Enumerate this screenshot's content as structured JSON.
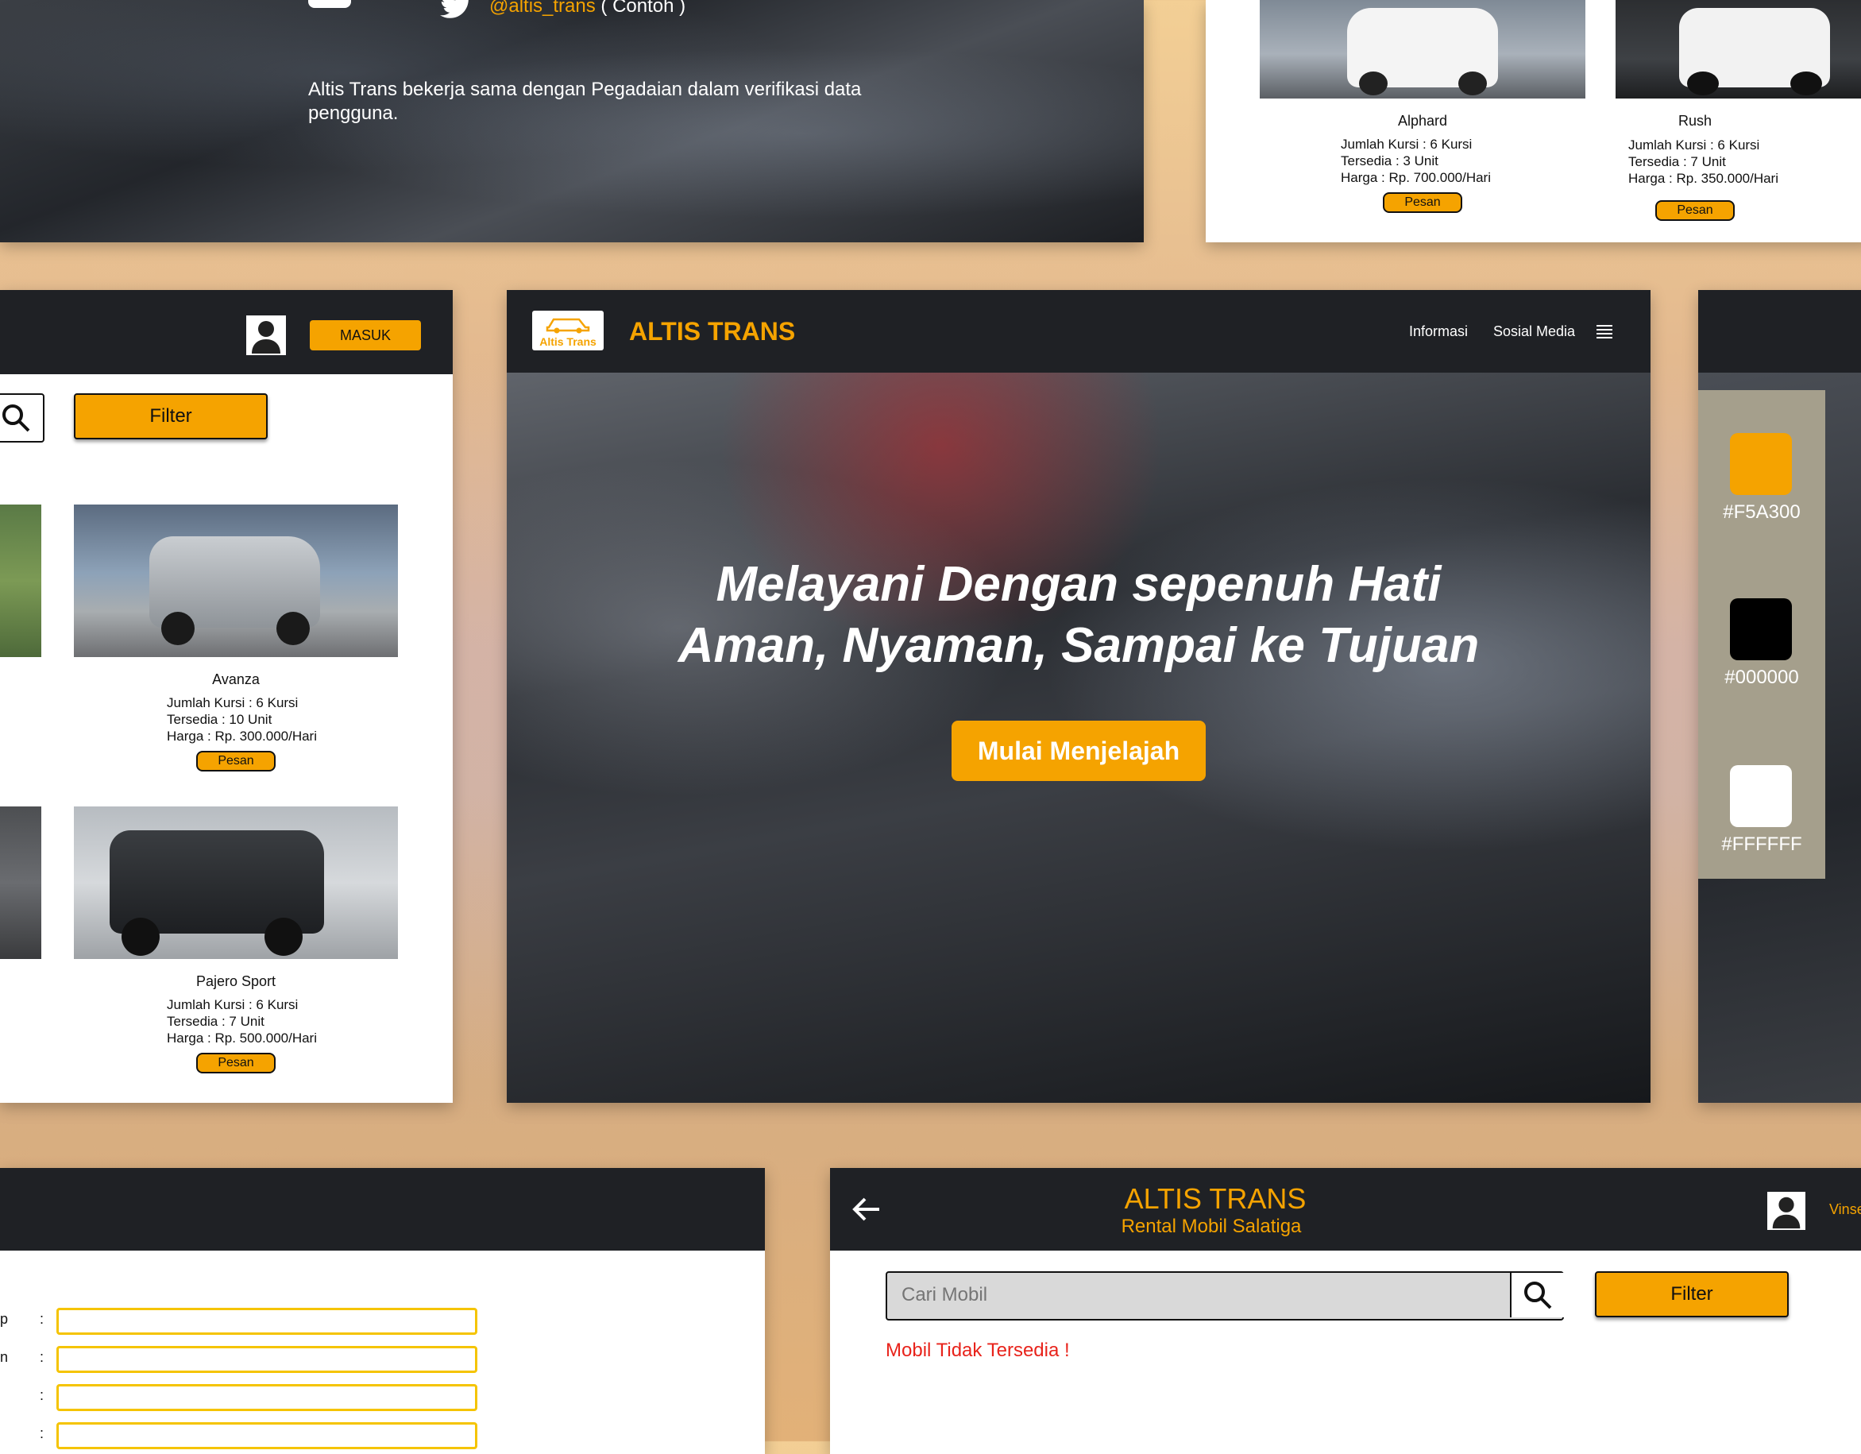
{
  "colors": {
    "accent": "#F5A300",
    "black": "#000000",
    "white": "#FFFFFF",
    "dark_bar": "#1f2125",
    "error": "#e8231b"
  },
  "top_left": {
    "twitter_handle": "@altis_trans",
    "twitter_note": " ( Contoh )",
    "description": "Altis Trans bekerja sama dengan Pegadaian dalam verifikasi data pengguna."
  },
  "top_right": {
    "cars": [
      {
        "name": "Alphard",
        "seats": "Jumlah Kursi : 6 Kursi",
        "stock": "Tersedia : 3 Unit",
        "price": "Harga : Rp. 700.000/Hari",
        "button": "Pesan"
      },
      {
        "name": "Rush",
        "seats": "Jumlah Kursi : 6 Kursi",
        "stock": "Tersedia : 7 Unit",
        "price": "Harga : Rp. 350.000/Hari",
        "button": "Pesan"
      }
    ]
  },
  "left_panel": {
    "login_button": "MASUK",
    "filter_button": "Filter",
    "cars": [
      {
        "name": "Avanza",
        "seats": "Jumlah Kursi : 6 Kursi",
        "stock": "Tersedia : 10 Unit",
        "price": "Harga : Rp. 300.000/Hari",
        "button": "Pesan"
      },
      {
        "name": "Pajero Sport",
        "seats": "Jumlah Kursi : 6 Kursi",
        "stock": "Tersedia : 7 Unit",
        "price": "Harga : Rp. 500.000/Hari",
        "button": "Pesan"
      }
    ]
  },
  "hero": {
    "logo_text": "Altis Trans",
    "brand": "ALTIS TRANS",
    "nav": [
      "Informasi",
      "Sosial Media"
    ],
    "headline_line1": "Melayani Dengan sepenuh Hati",
    "headline_line2": "Aman, Nyaman, Sampai ke Tujuan",
    "cta": "Mulai Menjelajah"
  },
  "palette": {
    "swatches": [
      {
        "hex": "#F5A300",
        "label": "#F5A300"
      },
      {
        "hex": "#000000",
        "label": "#000000"
      },
      {
        "hex": "#FFFFFF",
        "label": "#FFFFFF"
      }
    ]
  },
  "form_panel": {
    "label_fragments": [
      "p",
      "n",
      "",
      ""
    ],
    "separator": ":"
  },
  "search_panel": {
    "brand": "ALTIS TRANS",
    "subtitle": "Rental Mobil Salatiga",
    "user_name_fragment": "Vinse",
    "search_placeholder": "Cari Mobil",
    "filter_button": "Filter",
    "empty_message": "Mobil Tidak Tersedia !"
  }
}
